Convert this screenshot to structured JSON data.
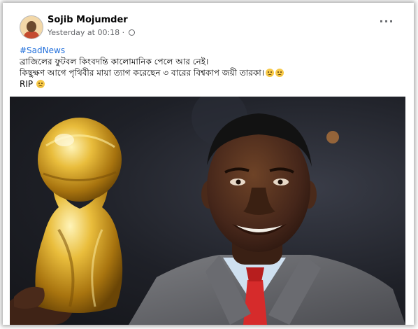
{
  "post": {
    "author": "Sojib Mojumder",
    "timestamp": "Yesterday at 00:18 ·",
    "hashtag": "#SadNews",
    "line1": "ব্রাজিলের ফুটবল কিংবদন্তি কালোমানিক পেলে আর নেই।",
    "line2": "কিছুক্ষণ আগে পৃথিবীর মায়া ত্যাগ করেছেন ৩ বারের বিশ্বকাপ জয়ী তারকা।",
    "line3": "RIP",
    "more_label": "···"
  },
  "icons": {
    "privacy": "globe-icon",
    "menu": "more-options-icon",
    "emoji": "sad-face-icon"
  },
  "colors": {
    "link": "#216fdb",
    "secondary_text": "#65676b",
    "trophy_gold": "#d4a21c",
    "tie": "#d62b2b"
  }
}
